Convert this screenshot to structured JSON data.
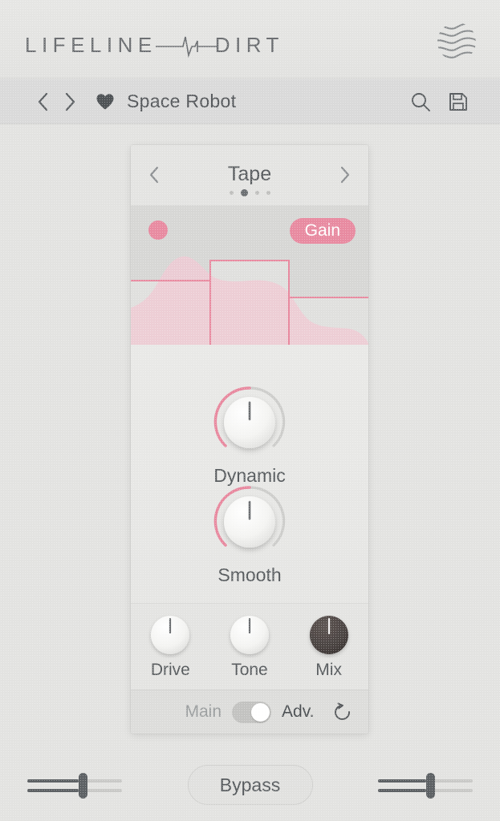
{
  "header": {
    "logo_part1": "LIFELINE",
    "logo_part2": "DIRT",
    "pulse_icon": "waveform-pulse-icon",
    "brand_icon": "waves-circle-logo"
  },
  "preset_bar": {
    "prev_icon": "chevron-left-icon",
    "next_icon": "chevron-right-icon",
    "favorite_icon": "heart-filled-icon",
    "preset_name": "Space Robot",
    "search_icon": "search-icon",
    "save_icon": "floppy-disk-save-icon"
  },
  "module": {
    "prev_icon": "chevron-left-icon",
    "next_icon": "chevron-right-icon",
    "title": "Tape",
    "page_count": 4,
    "active_page": 2,
    "visualizer": {
      "indicator_icon": "record-dot-icon",
      "badge_label": "Gain",
      "accent_color": "#e88ba1",
      "curve_color": "#e8899f",
      "fill_color": "#f0cfd6",
      "background": "#d7d7d5"
    },
    "big_knobs": [
      {
        "label": "Dynamic",
        "value_deg": 0,
        "arc_color": "#e8899f",
        "style": "light"
      },
      {
        "label": "Smooth",
        "value_deg": 0,
        "arc_color": "#e8899f",
        "style": "light"
      }
    ],
    "small_knobs": [
      {
        "label": "Drive",
        "value_deg": 0,
        "style": "light"
      },
      {
        "label": "Tone",
        "value_deg": 0,
        "style": "light"
      },
      {
        "label": "Mix",
        "value_deg": 0,
        "style": "dark",
        "color": "#4a4341"
      }
    ],
    "footer": {
      "main_label": "Main",
      "adv_label": "Adv.",
      "toggle_state": "adv",
      "reset_icon": "reset-undo-icon"
    }
  },
  "bottom_bar": {
    "input_slider": {
      "name": "input-level-slider",
      "position_pct": 58
    },
    "bypass_label": "Bypass",
    "output_slider": {
      "name": "output-level-slider",
      "position_pct": 54
    }
  }
}
